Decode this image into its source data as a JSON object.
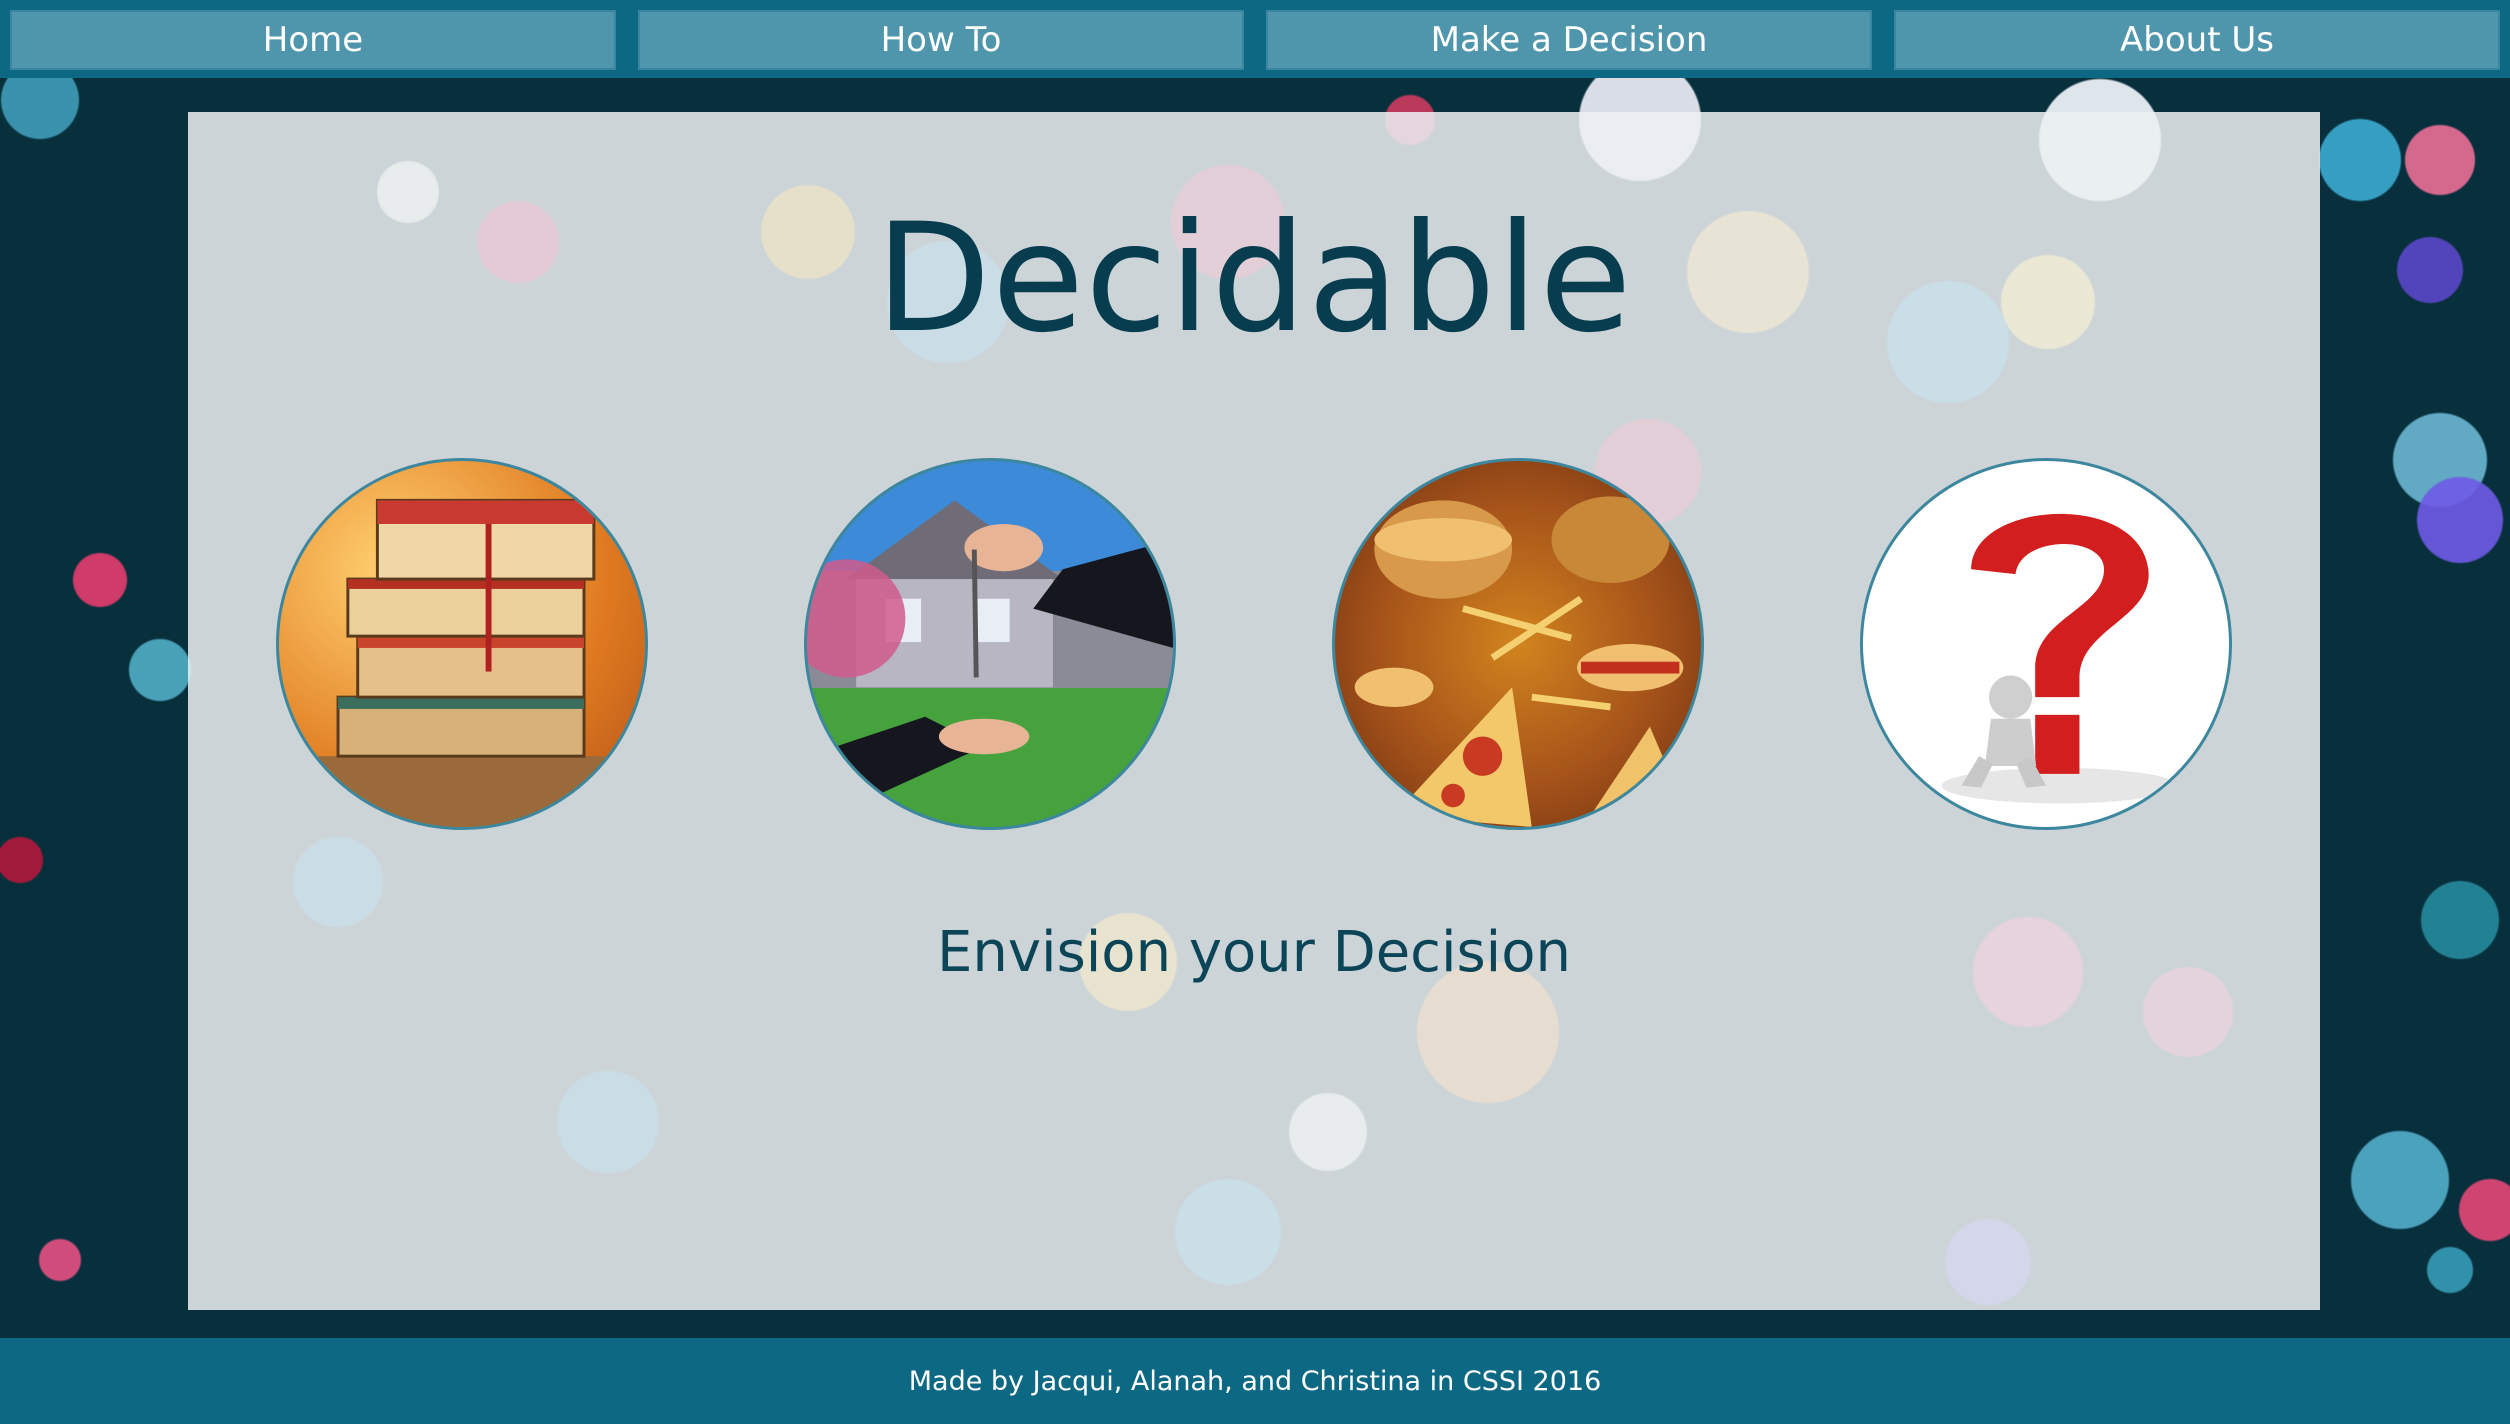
{
  "nav": {
    "items": [
      {
        "label": "Home"
      },
      {
        "label": "How To"
      },
      {
        "label": "Make a Decision"
      },
      {
        "label": "About Us"
      }
    ]
  },
  "main": {
    "title": "Decidable",
    "subtitle": "Envision your Decision",
    "images": [
      {
        "icon": "books-icon"
      },
      {
        "icon": "house-keys-icon"
      },
      {
        "icon": "fast-food-icon"
      },
      {
        "icon": "question-mark-icon"
      }
    ]
  },
  "footer": {
    "credit": "Made by Jacqui, Alanah, and Christina in CSSI 2016"
  },
  "colors": {
    "nav_bar": "#0d6884",
    "nav_button": "#4f96ac",
    "title": "#083d4f",
    "panel": "#ecf0f2"
  }
}
